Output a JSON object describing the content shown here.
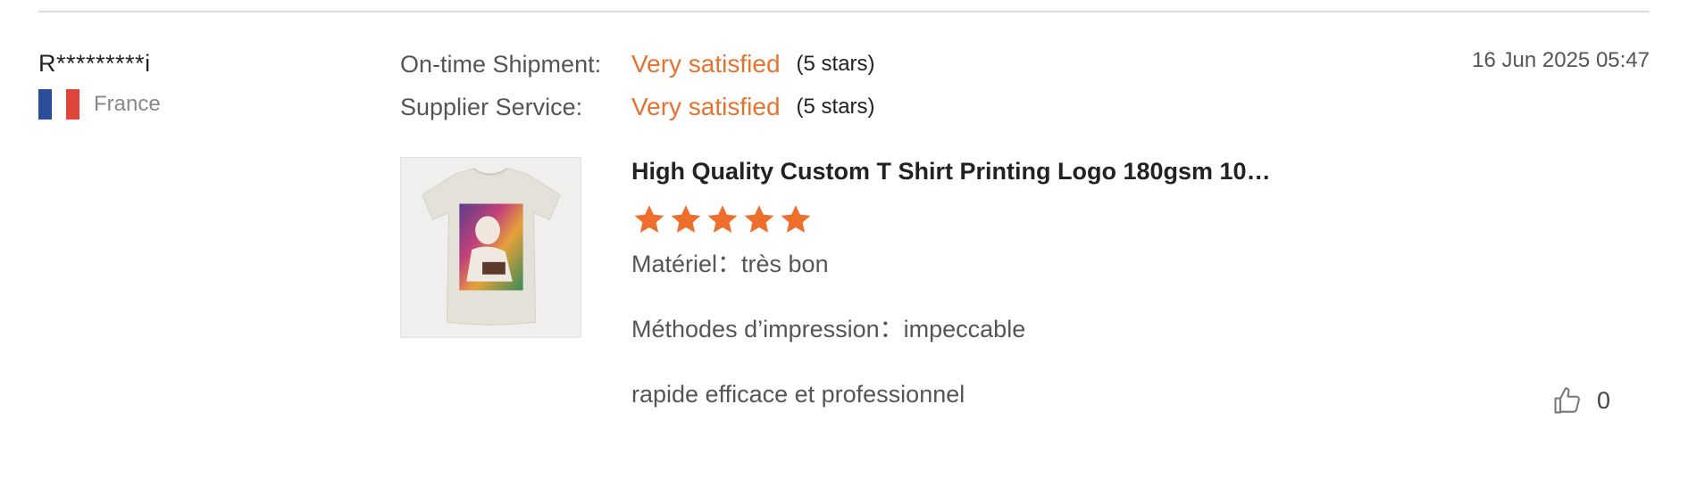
{
  "reviewer": {
    "name": "R*********i",
    "country": "France",
    "flag_icon": "france-flag-icon"
  },
  "ratings": [
    {
      "label": "On-time Shipment:",
      "value": "Very satisfied",
      "stars": "(5 stars)"
    },
    {
      "label": "Supplier Service:",
      "value": "Very satisfied",
      "stars": "(5 stars)"
    }
  ],
  "date": "16 Jun 2025 05:47",
  "product": {
    "title": "High Quality Custom T Shirt Printing Logo 180gsm 10…",
    "rating": 5,
    "image_icon": "tshirt-product-image"
  },
  "review": {
    "lines": [
      {
        "key": "Matériel：",
        "value": "très bon"
      },
      {
        "key": "Méthodes d’impression：",
        "value": "impeccable"
      },
      {
        "key": "",
        "value": "rapide efficace et professionnel"
      }
    ]
  },
  "like": {
    "count": "0",
    "icon": "thumbs-up-icon"
  },
  "colors": {
    "accent": "#e6732d",
    "star": "#ee6f2d",
    "divider": "#dcdcdc"
  }
}
